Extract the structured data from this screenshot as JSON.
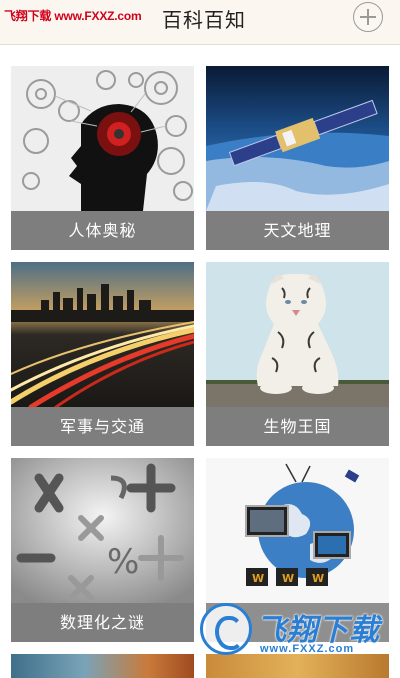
{
  "header": {
    "watermark": "飞翔下载 www.FXXZ.com",
    "title": "百科百知",
    "add_icon": "plus-circle-icon"
  },
  "cards": [
    {
      "label": "人体奥秘",
      "image": "brain-gears"
    },
    {
      "label": "天文地理",
      "image": "satellite-earth"
    },
    {
      "label": "军事与交通",
      "image": "city-highway-night"
    },
    {
      "label": "生物王国",
      "image": "white-tiger"
    },
    {
      "label": "数理化之谜",
      "image": "math-symbols"
    },
    {
      "label": "",
      "image": "globe-computers"
    }
  ],
  "watermark_logo": {
    "cn": "飞翔下载",
    "en": "www.FXXZ.com"
  }
}
